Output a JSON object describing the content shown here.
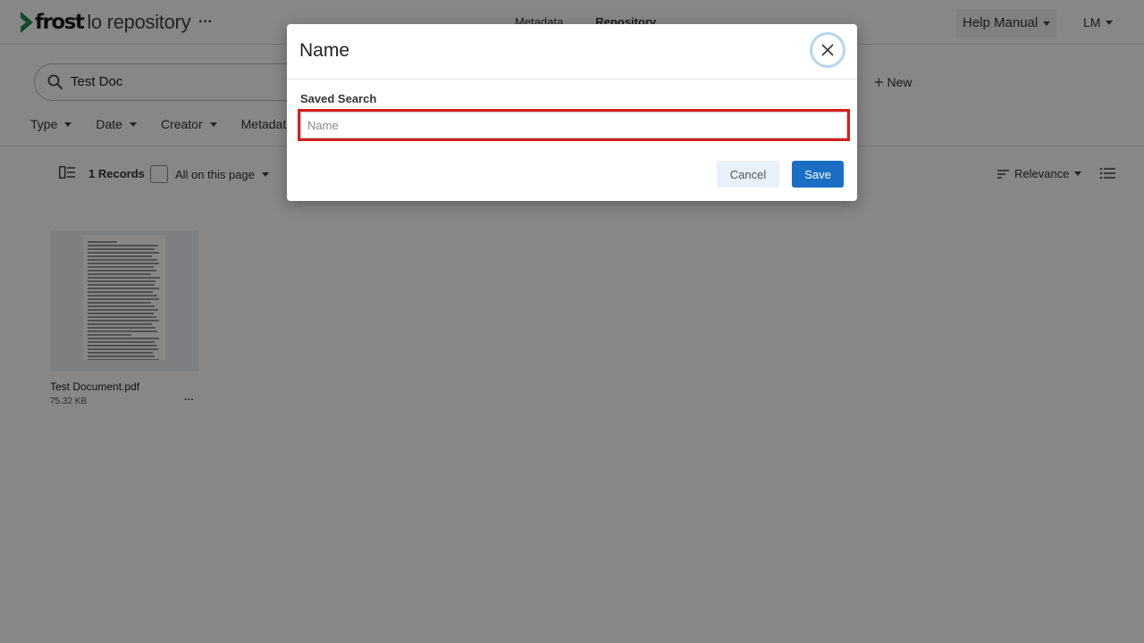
{
  "header": {
    "brand": "frost",
    "product": "lo repository",
    "more_label": "···",
    "nav": [
      {
        "label": "Metadata"
      },
      {
        "label": "Repository"
      }
    ],
    "help_label": "Help Manual",
    "user_initials": "LM"
  },
  "search": {
    "query": "Test Doc",
    "new_label": "New"
  },
  "filters": [
    {
      "label": "Type"
    },
    {
      "label": "Date"
    },
    {
      "label": "Creator"
    },
    {
      "label": "Metadata"
    }
  ],
  "toolbar": {
    "records_label": "1 Records",
    "select_label": "All on this page",
    "sort_label": "Relevance"
  },
  "results": [
    {
      "name": "Test Document.pdf",
      "size": "75.32 KB",
      "more_label": "···"
    }
  ],
  "modal": {
    "title": "Name",
    "field_label": "Saved Search",
    "input_placeholder": "Name",
    "input_value": "",
    "cancel_label": "Cancel",
    "save_label": "Save"
  },
  "colors": {
    "accent": "#1a6fc4",
    "brand_green": "#1f8a4c",
    "highlight_border": "#d61f1f",
    "overlay": "rgba(0,0,0,0.47)"
  }
}
